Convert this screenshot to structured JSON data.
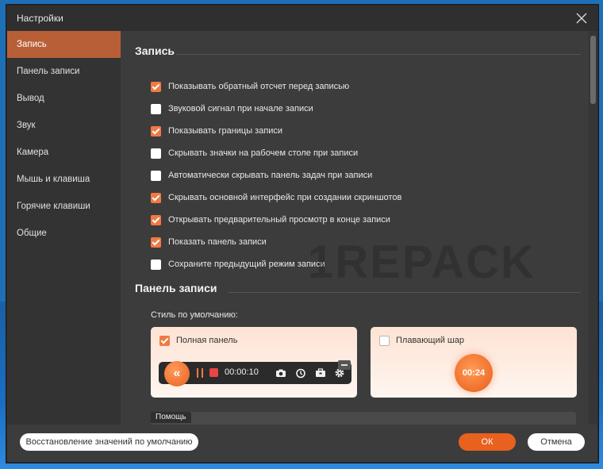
{
  "window": {
    "title": "Настройки"
  },
  "sidebar": {
    "items": [
      {
        "label": "Запись",
        "active": true
      },
      {
        "label": "Панель записи"
      },
      {
        "label": "Вывод"
      },
      {
        "label": "Звук"
      },
      {
        "label": "Камера"
      },
      {
        "label": "Мышь и клавиша"
      },
      {
        "label": "Горячие клавиши"
      },
      {
        "label": "Общие"
      }
    ]
  },
  "recording": {
    "title": "Запись",
    "options": [
      {
        "label": "Показывать обратный отсчет перед записью",
        "checked": true
      },
      {
        "label": "Звуковой сигнал при начале записи",
        "checked": false
      },
      {
        "label": "Показывать границы записи",
        "checked": true
      },
      {
        "label": "Скрывать значки на рабочем столе при записи",
        "checked": false
      },
      {
        "label": "Автоматически скрывать панель задач при записи",
        "checked": false
      },
      {
        "label": "Скрывать основной интерфейс при создании скриншотов",
        "checked": true
      },
      {
        "label": "Открывать предварительный просмотр в конце записи",
        "checked": true
      },
      {
        "label": "Показать панель записи",
        "checked": true
      },
      {
        "label": "Сохраните предыдущий режим записи",
        "checked": false
      }
    ]
  },
  "panel": {
    "title": "Панель записи",
    "style_label": "Стиль по умолчанию:",
    "full_panel": {
      "label": "Полная панель",
      "checked": true,
      "time": "00:00:10"
    },
    "floating_ball": {
      "label": "Плавающий шар",
      "checked": false,
      "time": "00:24"
    }
  },
  "help": {
    "label": "Помощь"
  },
  "footer": {
    "reset_label": "Восстановление значений по умолчанию",
    "ok_label": "ОК",
    "cancel_label": "Отмена"
  },
  "watermark": "1REPACK",
  "colors": {
    "accent": "#ef7a43",
    "active_sidebar": "#b85f38",
    "background": "#3c3c3c"
  },
  "icons": [
    "close-icon",
    "rewind-icon",
    "pause-icon",
    "stop-icon",
    "camera-icon",
    "timer-icon",
    "toolbox-icon",
    "gear-icon",
    "minimize-icon"
  ]
}
